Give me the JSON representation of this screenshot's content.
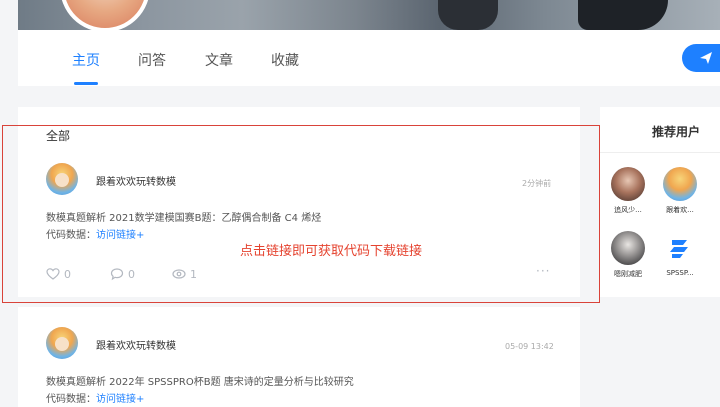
{
  "tabs": [
    {
      "label": "主页",
      "active": true
    },
    {
      "label": "问答",
      "active": false
    },
    {
      "label": "文章",
      "active": false
    },
    {
      "label": "收藏",
      "active": false
    }
  ],
  "feed": {
    "section_title": "全部",
    "posts": [
      {
        "author": "跟着欢欢玩转数模",
        "time": "2分钟前",
        "title": "数模真题解析 2021数学建模国赛B题：乙醇偶合制备 C4 烯烃",
        "code_prefix": "代码数据：",
        "code_link": "访问链接+",
        "likes": "0",
        "comments": "0",
        "views": "1"
      },
      {
        "author": "跟着欢欢玩转数模",
        "time": "05-09 13:42",
        "title": "数模真题解析 2022年 SPSSPRO杯B题 唐宋诗的定量分析与比较研究",
        "code_prefix": "代码数据：",
        "code_link": "访问链接+"
      }
    ],
    "more_label": "···"
  },
  "annotation": "点击链接即可获取代码下载链接",
  "sidebar": {
    "title": "推荐用户",
    "users": [
      {
        "name": "追风少..."
      },
      {
        "name": "跟着欢..."
      },
      {
        "name": "嗯刚减肥"
      },
      {
        "name": "SPSSP..."
      }
    ]
  },
  "colors": {
    "accent": "#1e80ff",
    "annotation": "#e5432f",
    "highlight_border": "#d9433a"
  },
  "icons": [
    "send-icon",
    "like-icon",
    "comment-icon",
    "view-icon",
    "more-icon",
    "spsspro-logo-icon"
  ]
}
